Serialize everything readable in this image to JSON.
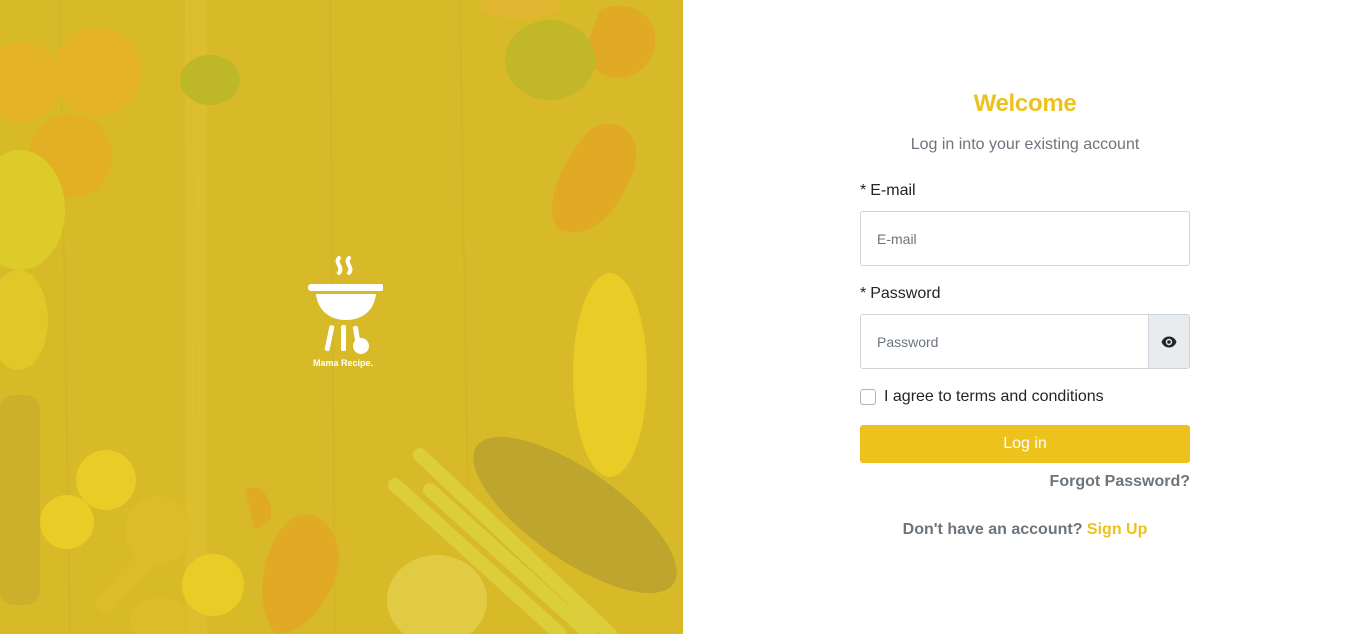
{
  "brand": {
    "name": "Mama Recipe."
  },
  "login": {
    "title": "Welcome",
    "subtitle": "Log in into your existing account",
    "email_required": "*",
    "email_label": "E-mail",
    "email_placeholder": "E-mail",
    "email_value": "",
    "password_required": "*",
    "password_label": "Password",
    "password_placeholder": "Password",
    "password_value": "",
    "password_toggle_icon": "eye-icon",
    "terms_checked": false,
    "terms_label": "I agree to terms and conditions",
    "login_button": "Log in",
    "forgot_password": "Forgot Password?",
    "no_account_text": "Don't have an account?",
    "signup_link": "Sign Up"
  },
  "colors": {
    "accent": "#eec21d",
    "muted_text": "#6c757d",
    "left_overlay": "#e4c92a"
  }
}
